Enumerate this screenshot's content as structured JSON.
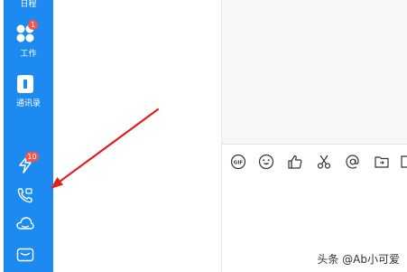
{
  "sidebar": {
    "items": [
      {
        "label": "日程",
        "icon": "calendar-icon"
      },
      {
        "label": "工作",
        "icon": "apps-icon",
        "badge": "1"
      },
      {
        "label": "通讯录",
        "icon": "contacts-icon"
      },
      {
        "label": "",
        "icon": "lightning-icon",
        "badge": "10"
      },
      {
        "label": "",
        "icon": "phone-call-icon"
      },
      {
        "label": "",
        "icon": "cloud-icon"
      },
      {
        "label": "",
        "icon": "mail-icon"
      }
    ]
  },
  "toolbar": {
    "tools": [
      "gif-icon",
      "emoji-icon",
      "thumbs-up-icon",
      "scissors-icon",
      "at-mention-icon",
      "folder-icon",
      "more-icon"
    ]
  },
  "watermark": "头条 @Ab小可爱",
  "colors": {
    "sidebar": "#1d8af2",
    "annotation_arrow": "#e02020",
    "badge": "#f2554f"
  }
}
